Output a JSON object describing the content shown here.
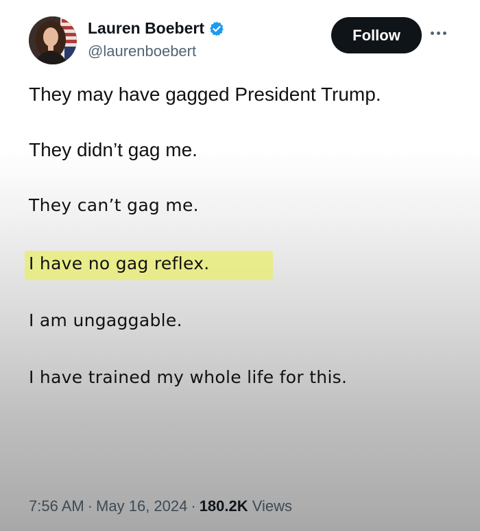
{
  "author": {
    "display_name": "Lauren Boebert",
    "handle": "@laurenboebert",
    "verified_icon": "verified-badge-icon",
    "verified_color": "#1d9bf0"
  },
  "follow_button": {
    "label": "Follow"
  },
  "more_menu_icon": "more-options-icon",
  "body_lines": [
    "They may have gagged President Trump.",
    "They didn’t gag me.",
    "They can’t gag me.",
    "I have no gag reflex.",
    "I am ungaggable.",
    "I have trained my whole life for this."
  ],
  "highlight_color": "#e9ec7a",
  "meta": {
    "time": "7:56 AM",
    "separator": "·",
    "date": "May 16, 2024",
    "views_count": "180.2K",
    "views_label": "Views"
  }
}
